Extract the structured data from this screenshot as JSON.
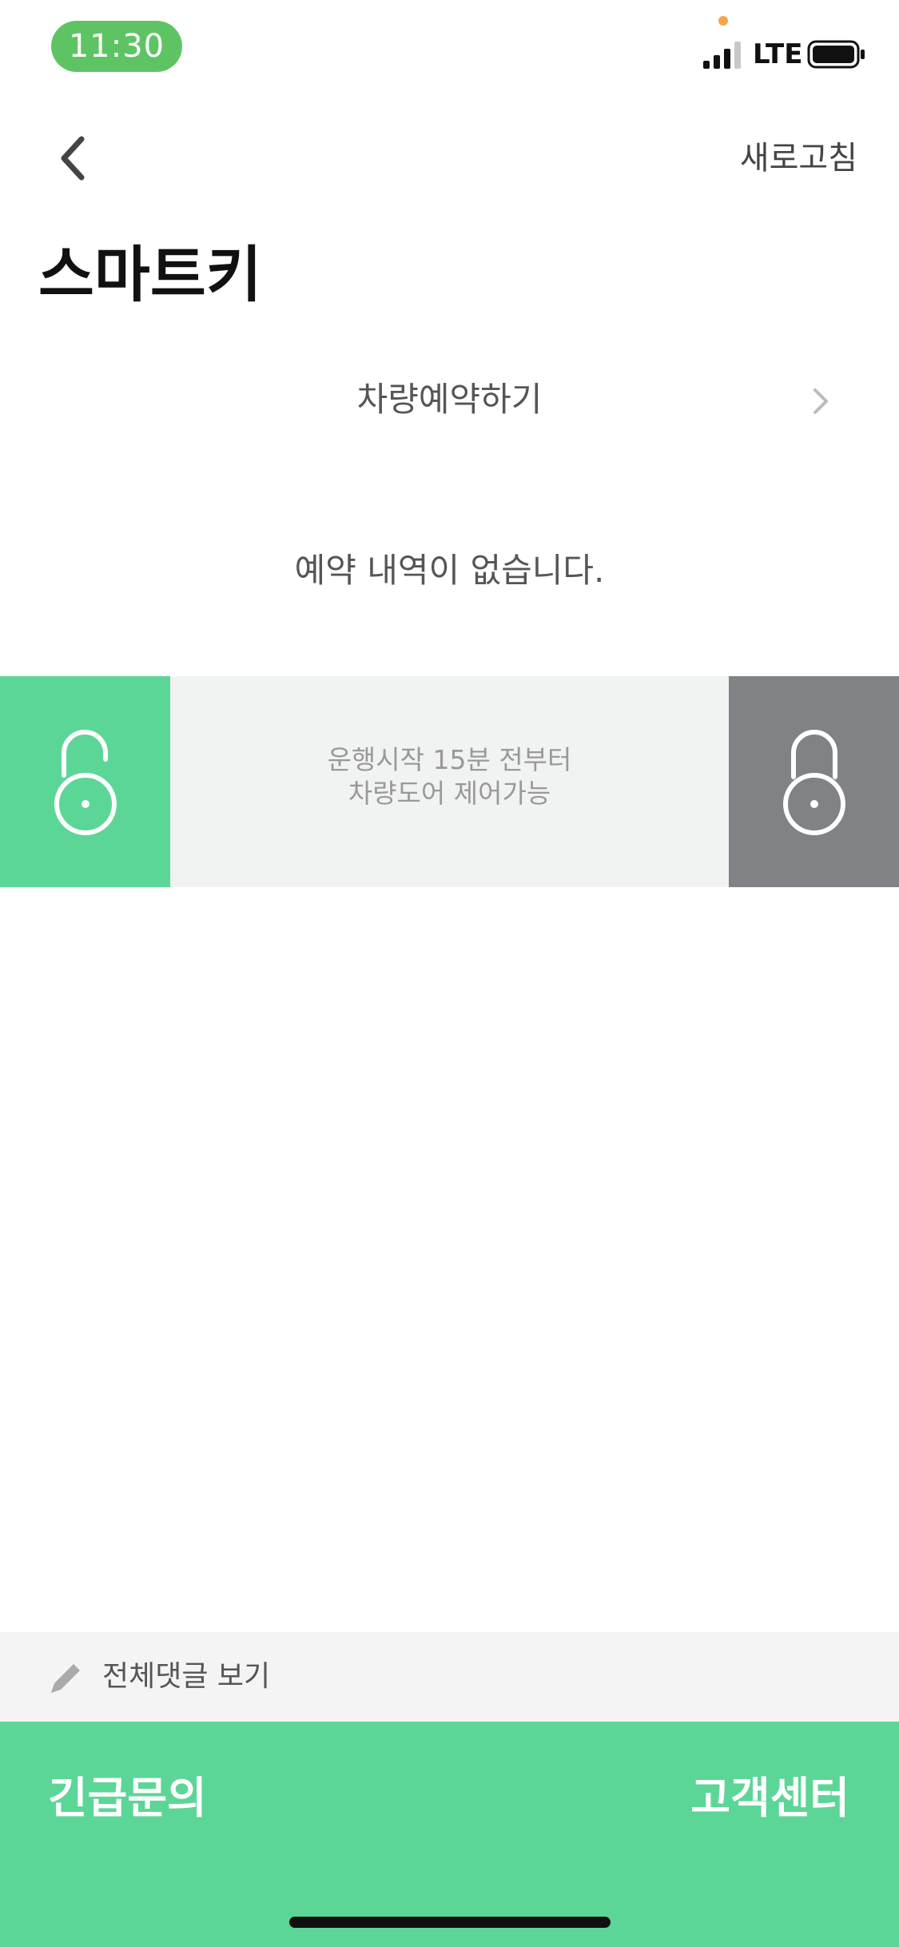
{
  "status_bar": {
    "time": "11:30",
    "network": "LTE",
    "icons": [
      "signal-icon",
      "battery-icon"
    ],
    "accent_color": "#5ec463"
  },
  "nav": {
    "back_icon": "chevron-left-icon",
    "refresh_label": "새로고침"
  },
  "page": {
    "title": "스마트키"
  },
  "reservation": {
    "link_label": "차량예약하기",
    "chevron_icon": "chevron-right-icon",
    "empty_message": "예약 내역이 없습니다."
  },
  "door_control": {
    "unlock_icon": "unlocked-padlock-icon",
    "lock_icon": "locked-padlock-icon",
    "note_line1": "운행시작 15분 전부터",
    "note_line2": "차량도어 제어가능",
    "unlock_color": "#5cd697",
    "lock_color": "#808285"
  },
  "comments": {
    "icon": "pencil-icon",
    "label": "전체댓글 보기"
  },
  "action_bar": {
    "emergency_label": "긴급문의",
    "support_label": "고객센터",
    "color": "#5cd697"
  }
}
